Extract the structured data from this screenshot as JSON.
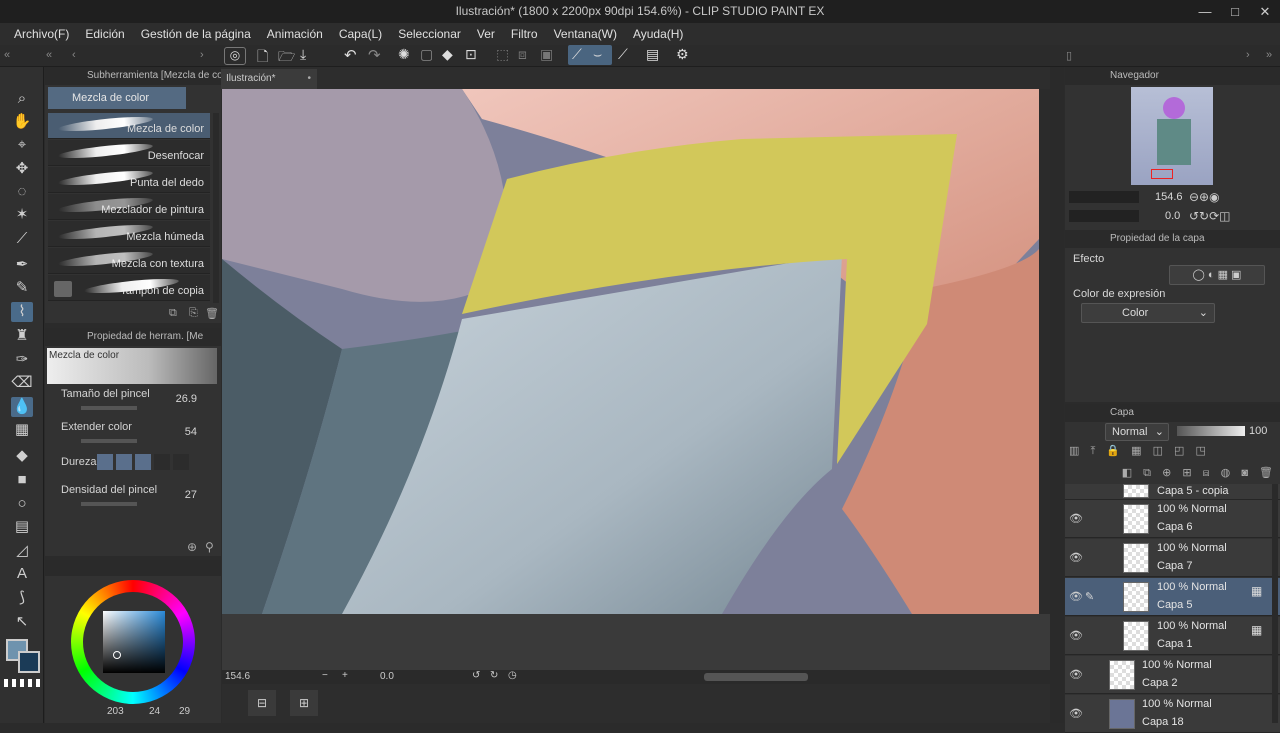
{
  "window": {
    "title": "Ilustración* (1800 x 2200px 90dpi 154.6%)  - CLIP STUDIO PAINT EX",
    "controls": [
      "—",
      "□",
      "✕"
    ]
  },
  "menu": [
    "Archivo(F)",
    "Edición",
    "Gestión de la página",
    "Animación",
    "Capa(L)",
    "Seleccionar",
    "Ver",
    "Filtro",
    "Ventana(W)",
    "Ayuda(H)"
  ],
  "subtool_panel": {
    "header": "Subherramienta [Mezcla de colo",
    "group_label": "Mezcla de color",
    "items": [
      {
        "label": "Mezcla de color",
        "selected": true
      },
      {
        "label": "Desenfocar",
        "selected": false
      },
      {
        "label": "Punta del dedo",
        "selected": false
      },
      {
        "label": "Mezclador de pintura",
        "selected": false
      },
      {
        "label": "Mezcla húmeda",
        "selected": false
      },
      {
        "label": "Mezcla con textura",
        "selected": false
      },
      {
        "label": "Tampón de copia",
        "selected": false
      }
    ]
  },
  "tool_property": {
    "header": "Propiedad de herram. [Me",
    "preview_label": "Mezcla de color",
    "brush_size_label": "Tamaño del pincel",
    "brush_size_value": "26.9",
    "extend_color_label": "Extender color",
    "extend_color_value": "54",
    "hardness_label": "Dureza",
    "density_label": "Densidad del pincel",
    "density_value": "27"
  },
  "color": {
    "main": "#6e93ae",
    "sub": "#1b3b57",
    "r": "203",
    "g": "24",
    "b": "29"
  },
  "canvas": {
    "tab_label": "Ilustración*",
    "zoom": "154.6",
    "rotation": "0.0"
  },
  "navigator": {
    "header": "Navegador",
    "zoom": "154.6",
    "rotation": "0.0"
  },
  "layer_property": {
    "header": "Propiedad de la capa",
    "effect_label": "Efecto",
    "expression_color_label": "Color de expresión",
    "expression_color_value": "Color"
  },
  "layers_panel": {
    "header": "Capa",
    "blend_mode": "Normal",
    "opacity": "100",
    "layers": [
      {
        "mode": "",
        "name": "Capa 5 - copia",
        "visible": false,
        "selected": false
      },
      {
        "mode": "100 % Normal",
        "name": "Capa 6",
        "visible": true,
        "selected": false
      },
      {
        "mode": "100 % Normal",
        "name": "Capa 7",
        "visible": true,
        "selected": false
      },
      {
        "mode": "100 % Normal",
        "name": "Capa 5",
        "visible": true,
        "selected": true
      },
      {
        "mode": "100 % Normal",
        "name": "Capa 1",
        "visible": true,
        "selected": false
      },
      {
        "mode": "100 % Normal",
        "name": "Capa 2",
        "visible": true,
        "selected": false
      },
      {
        "mode": "100 % Normal",
        "name": "Capa 18",
        "visible": true,
        "selected": false
      }
    ]
  }
}
